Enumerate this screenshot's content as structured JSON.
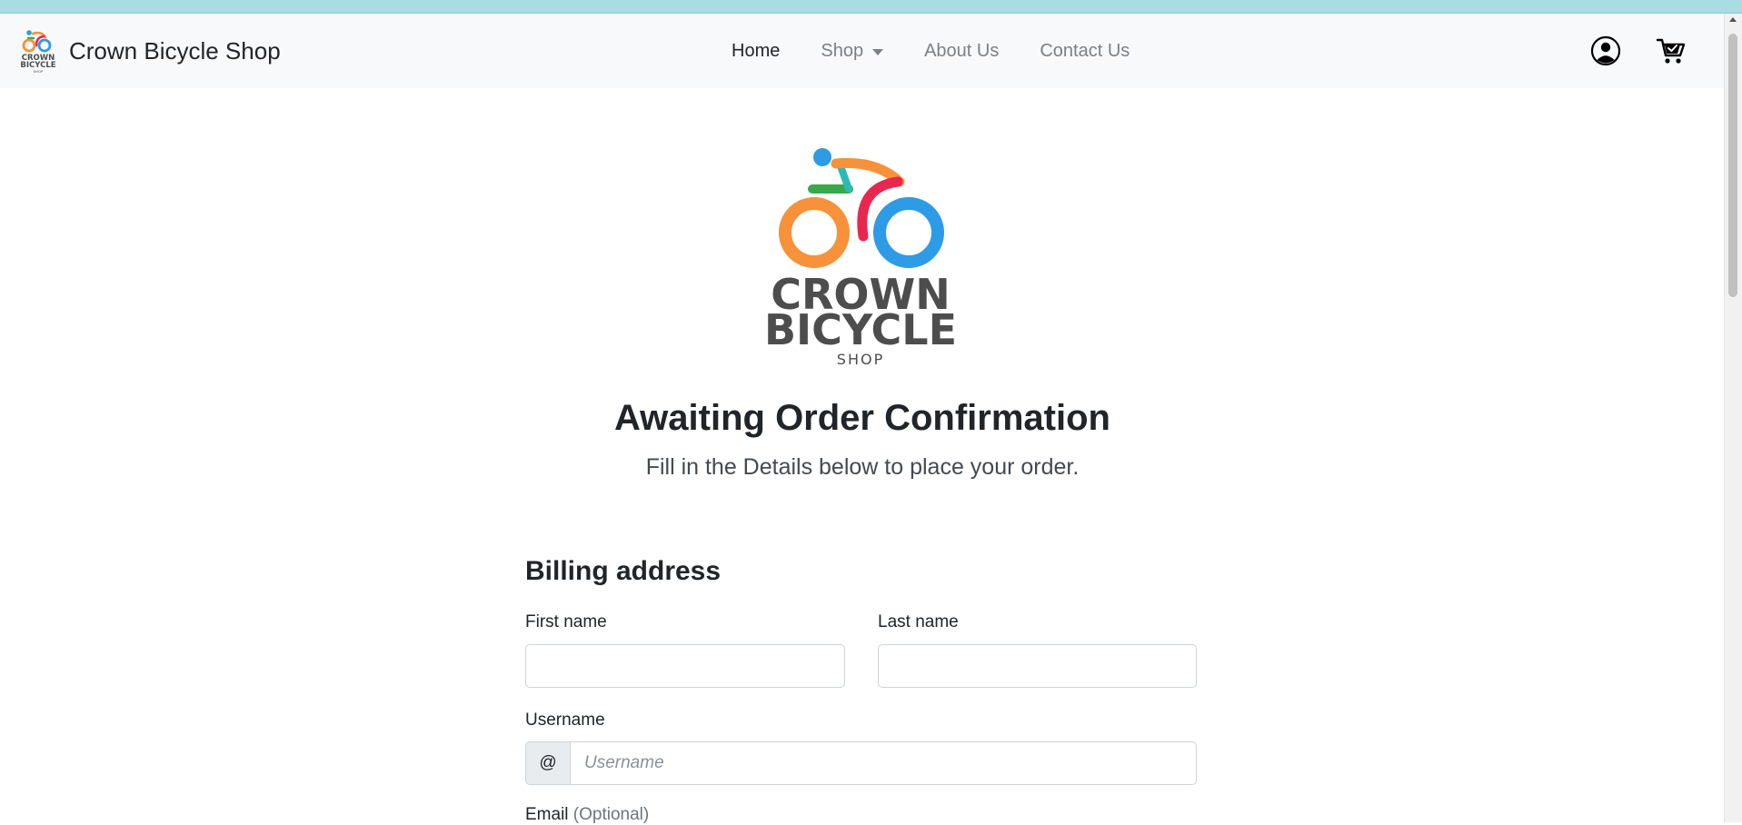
{
  "navbar": {
    "brand": "Crown Bicycle Shop",
    "links": [
      {
        "label": "Home",
        "active": true
      },
      {
        "label": "Shop",
        "dropdown": true
      },
      {
        "label": "About Us"
      },
      {
        "label": "Contact Us"
      }
    ],
    "icons": [
      "user-circle-icon",
      "cart-icon"
    ]
  },
  "hero": {
    "logo": {
      "line1": "CROWN",
      "line2": "BICYCLE",
      "line3": "SHOP"
    },
    "title": "Awaiting Order Confirmation",
    "subtitle": "Fill in the Details below to place your order."
  },
  "form": {
    "section_title": "Billing address",
    "first_name": {
      "label": "First name",
      "value": ""
    },
    "last_name": {
      "label": "Last name",
      "value": ""
    },
    "username": {
      "label": "Username",
      "prefix": "@",
      "placeholder": "Username"
    },
    "email": {
      "label": "Email",
      "optional": "(Optional)"
    }
  },
  "colors": {
    "navbar_bg": "#f8f9fa",
    "orange": "#f7913a",
    "blue": "#2e9be6",
    "red": "#e8274f",
    "green": "#3aa74a",
    "teal": "#2bbbb4",
    "logo_text": "#4d4d4d"
  }
}
